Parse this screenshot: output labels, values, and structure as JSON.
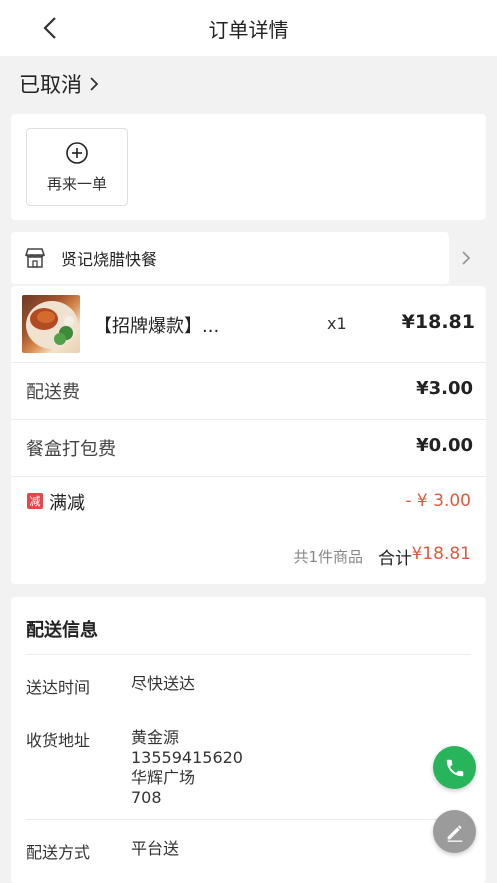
{
  "header": {
    "title": "订单详情",
    "back_icon": "chevron-left-icon"
  },
  "status": {
    "label": "已取消",
    "chevron_icon": "chevron-right-icon"
  },
  "actions": {
    "reorder_label": "再来一单",
    "reorder_icon": "plus-circle-icon"
  },
  "shop": {
    "name": "贤记烧腊快餐",
    "icon": "store-icon"
  },
  "item": {
    "name": "【招牌爆款】...",
    "qty": "x1",
    "price": "¥18.81"
  },
  "fees": [
    {
      "label": "配送费",
      "value": "¥3.00"
    },
    {
      "label": "餐盒打包费",
      "value": "¥0.00"
    }
  ],
  "discount": {
    "badge": "减",
    "label": "满减",
    "value": "- ¥ 3.00"
  },
  "total": {
    "count": "共1件商品",
    "label": "合计",
    "value": "¥18.81"
  },
  "delivery": {
    "title": "配送信息",
    "time_label": "送达时间",
    "time_value": "尽快送达",
    "address_label": "收货地址",
    "address_lines": [
      "黄金源",
      "13559415620",
      "华辉广场",
      "708"
    ],
    "method_label": "配送方式",
    "method_value": "平台送"
  },
  "colors": {
    "accent_red": "#e0593d",
    "call_green": "#27b45a",
    "badge_red": "#e8454a"
  }
}
